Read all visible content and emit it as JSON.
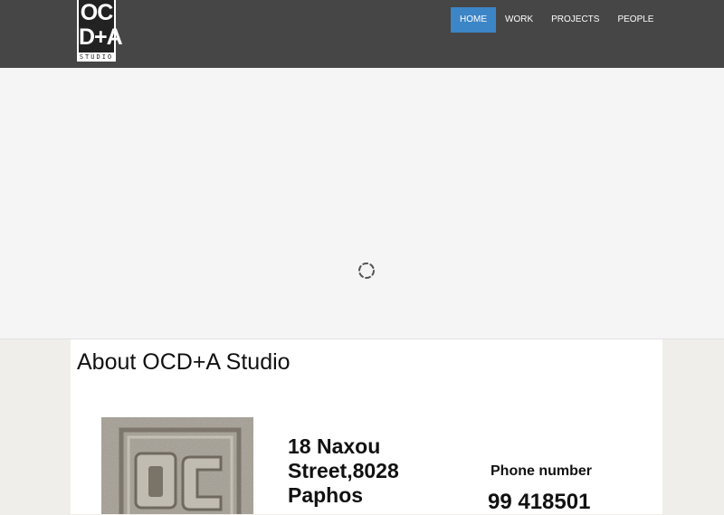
{
  "logo": {
    "line1": "OC",
    "line2": "D+A",
    "line3": "STUDIO"
  },
  "nav": {
    "items": [
      {
        "label": "HOME",
        "active": true
      },
      {
        "label": "WORK",
        "active": false
      },
      {
        "label": "PROJECTS",
        "active": false
      },
      {
        "label": "PEOPLE",
        "active": false
      }
    ]
  },
  "hero": {
    "loading_icon": "spinner-icon"
  },
  "about": {
    "title": "About OCD+A Studio",
    "image_icon": "stone-carved-logo",
    "address": "18 Naxou Street,8028 Paphos",
    "phone_label": "Phone number",
    "phone_number": "99 418501"
  },
  "colors": {
    "header_bg": "#464646",
    "nav_active": "#3c85c6",
    "hero_bg": "#f5f5f5",
    "page_bg": "#efeeea"
  }
}
